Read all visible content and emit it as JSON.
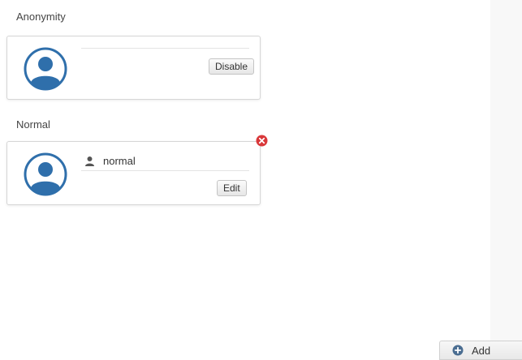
{
  "sections": {
    "anonymity_title": "Anonymity",
    "normal_title": "Normal"
  },
  "anonymity_card": {
    "disable_label": "Disable"
  },
  "normal_card": {
    "username": "normal",
    "edit_label": "Edit"
  },
  "footer": {
    "add_label": "Add"
  },
  "colors": {
    "avatar_blue": "#2f6fab",
    "remove_red": "#d9383a",
    "add_icon_blue": "#4a6d91"
  },
  "icons": {
    "avatar": "avatar-icon",
    "user": "user-icon",
    "remove": "remove-icon",
    "add": "plus-circle-icon"
  }
}
